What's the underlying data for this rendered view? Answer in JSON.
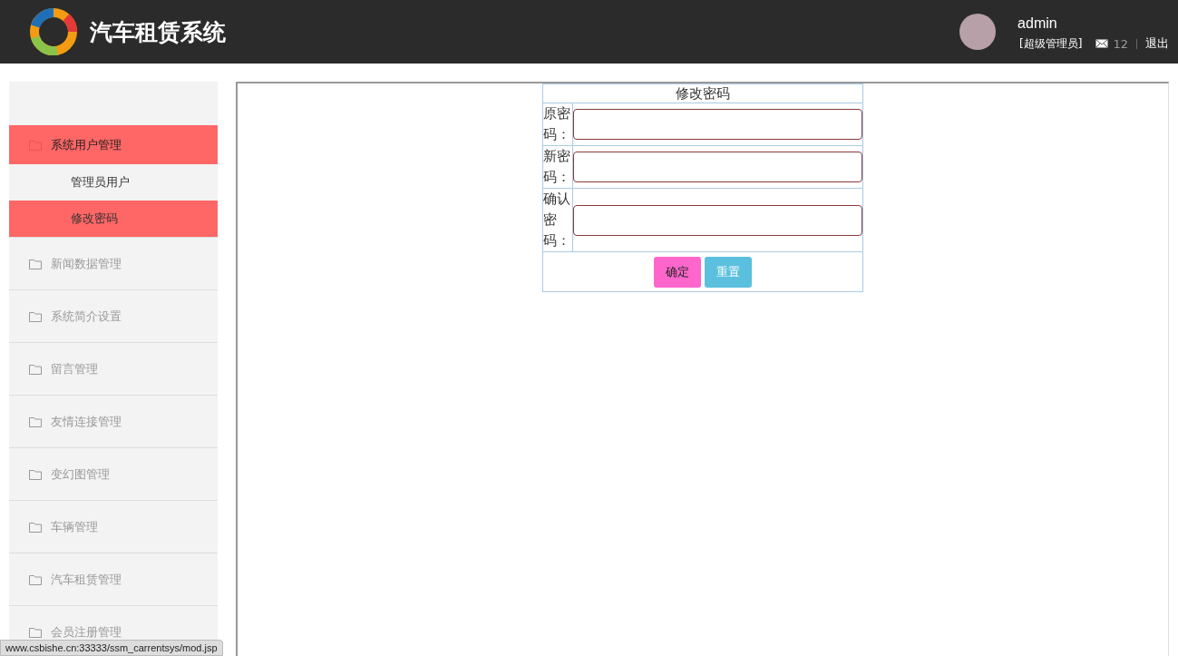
{
  "header": {
    "title": "汽车租赁系统",
    "user": {
      "name": "admin",
      "role": "[超级管理员]",
      "messages": "12",
      "logout": "退出"
    }
  },
  "sidebar": {
    "items": [
      {
        "label": "系统用户管理",
        "selected": true,
        "expanded": true,
        "children": [
          {
            "label": "管理员用户",
            "selected": false
          },
          {
            "label": "修改密码",
            "selected": true
          }
        ]
      },
      {
        "label": "新闻数据管理",
        "selected": false
      },
      {
        "label": "系统简介设置",
        "selected": false
      },
      {
        "label": "留言管理",
        "selected": false
      },
      {
        "label": "友情连接管理",
        "selected": false
      },
      {
        "label": "变幻图管理",
        "selected": false
      },
      {
        "label": "车辆管理",
        "selected": false
      },
      {
        "label": "汽车租赁管理",
        "selected": false
      },
      {
        "label": "会员注册管理",
        "selected": false
      }
    ]
  },
  "form": {
    "title": "修改密码",
    "fields": [
      {
        "label": "原密码："
      },
      {
        "label": "新密码："
      },
      {
        "label": "确认密码："
      }
    ],
    "buttons": [
      {
        "label": "确定",
        "kind": "submit"
      },
      {
        "label": "重置",
        "kind": "reset"
      }
    ]
  },
  "status_bar": {
    "url": "www.csbishe.cn:33333/ssm_carrentsys/mod.jsp"
  }
}
